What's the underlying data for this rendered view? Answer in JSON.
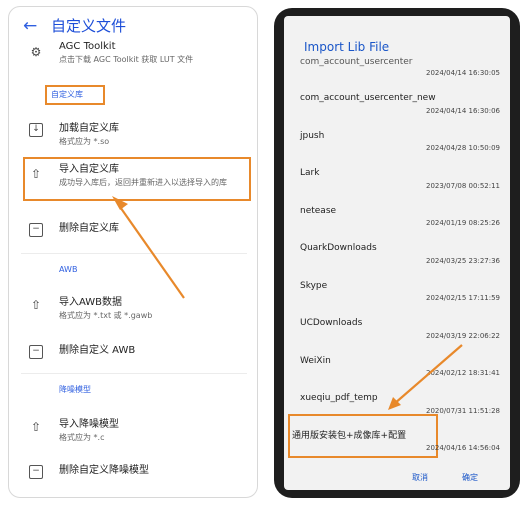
{
  "left": {
    "back_icon": "back-arrow-icon",
    "title": "自定义文件",
    "top_item": {
      "label": "AGC Toolkit",
      "desc": "点击下载 AGC Toolkit 获取 LUT 文件"
    },
    "section_custom_lib": "自定义库",
    "items": [
      {
        "label": "加载自定义库",
        "desc": "格式应为 *.so",
        "icon": "file-import-icon"
      },
      {
        "label": "导入自定义库",
        "desc": "成功导入库后，返回并重新进入以选择导入的库",
        "icon": "upload-icon"
      },
      {
        "label": "删除自定义库",
        "desc": "",
        "icon": "file-delete-icon"
      }
    ],
    "section_awb": "AWB",
    "awb_items": [
      {
        "label": "导入AWB数据",
        "desc": "格式应为 *.txt 或 *.gawb",
        "icon": "upload-icon"
      },
      {
        "label": "删除自定义 AWB",
        "desc": "",
        "icon": "file-delete-icon"
      }
    ],
    "section_noise": "降噪模型",
    "noise_items": [
      {
        "label": "导入降噪模型",
        "desc": "格式应为 *.c",
        "icon": "upload-icon"
      },
      {
        "label": "删除自定义降噪模型",
        "desc": "",
        "icon": "file-delete-icon"
      }
    ]
  },
  "right": {
    "title": "Import Lib File",
    "files": [
      {
        "name": "com_account_usercenter",
        "date": "2024/04/14 16:30:05"
      },
      {
        "name": "com_account_usercenter_new",
        "date": "2024/04/14 16:30:06"
      },
      {
        "name": "jpush",
        "date": "2024/04/28 10:50:09"
      },
      {
        "name": "Lark",
        "date": "2023/07/08 00:52:11"
      },
      {
        "name": "netease",
        "date": "2024/01/19 08:25:26"
      },
      {
        "name": "QuarkDownloads",
        "date": "2024/03/25 23:27:36"
      },
      {
        "name": "Skype",
        "date": "2024/02/15 17:11:59"
      },
      {
        "name": "UCDownloads",
        "date": "2024/03/19 22:06:22"
      },
      {
        "name": "WeiXin",
        "date": "2024/02/12 18:31:41"
      },
      {
        "name": "xueqiu_pdf_temp",
        "date": "2020/07/31 11:51:28"
      },
      {
        "name": "通用版安装包+成像库+配置",
        "date": "2024/04/16 14:56:04"
      }
    ],
    "cancel_label": "取消",
    "confirm_label": "确定"
  },
  "colors": {
    "accent": "#1a56c8",
    "highlight": "#e8892b",
    "phone_frame": "#1e1e1e"
  }
}
